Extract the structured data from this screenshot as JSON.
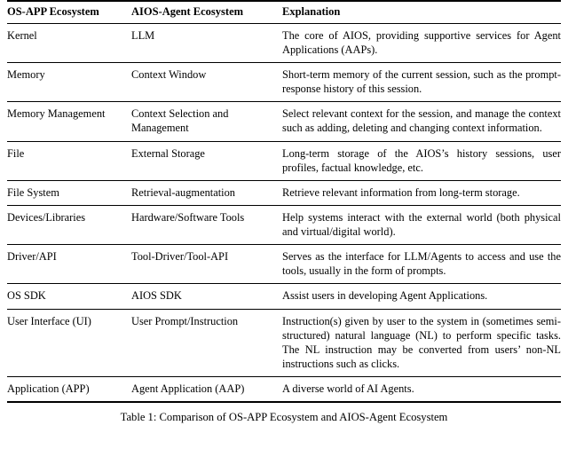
{
  "table": {
    "columns": [
      {
        "key": "os_app",
        "label": "OS-APP Ecosystem"
      },
      {
        "key": "aios_agent",
        "label": "AIOS-Agent Ecosystem"
      },
      {
        "key": "explanation",
        "label": "Explanation"
      }
    ],
    "rows": [
      {
        "os_app": "Kernel",
        "aios_agent": "LLM",
        "explanation": "The core of AIOS, providing supportive services for Agent Applications (AAPs)."
      },
      {
        "os_app": "Memory",
        "aios_agent": "Context Window",
        "explanation": "Short-term memory of the current session, such as the prompt-response history of this session."
      },
      {
        "os_app": "Memory Management",
        "aios_agent": "Context Selection and Management",
        "explanation": "Select relevant context for the session, and manage the context such as adding, deleting and changing context information."
      },
      {
        "os_app": "File",
        "aios_agent": "External Storage",
        "explanation": "Long-term storage of the AIOS’s history sessions, user profiles, factual knowledge, etc."
      },
      {
        "os_app": "File System",
        "aios_agent": "Retrieval-augmentation",
        "explanation": "Retrieve relevant information from long-term storage."
      },
      {
        "os_app": "Devices/Libraries",
        "aios_agent": "Hardware/Software Tools",
        "explanation": "Help systems interact with the external world (both physical and virtual/digital world)."
      },
      {
        "os_app": "Driver/API",
        "aios_agent": "Tool-Driver/Tool-API",
        "explanation": "Serves as the interface for LLM/Agents to access and use the tools, usually in the form of prompts."
      },
      {
        "os_app": "OS SDK",
        "aios_agent": "AIOS SDK",
        "explanation": "Assist users in developing Agent Applications."
      },
      {
        "os_app": "User Interface (UI)",
        "aios_agent": "User Prompt/Instruction",
        "explanation": "Instruction(s) given by user to the system in (some­times semi-structured) natural language (NL) to per­form specific tasks. The NL instruction may be con­verted from users’ non-NL instructions such as clicks."
      },
      {
        "os_app": "Application (APP)",
        "aios_agent": "Agent Application (AAP)",
        "explanation": "A diverse world of AI Agents."
      }
    ]
  },
  "caption": "Table 1: Comparison of OS-APP Ecosystem and AIOS-Agent Ecosystem"
}
